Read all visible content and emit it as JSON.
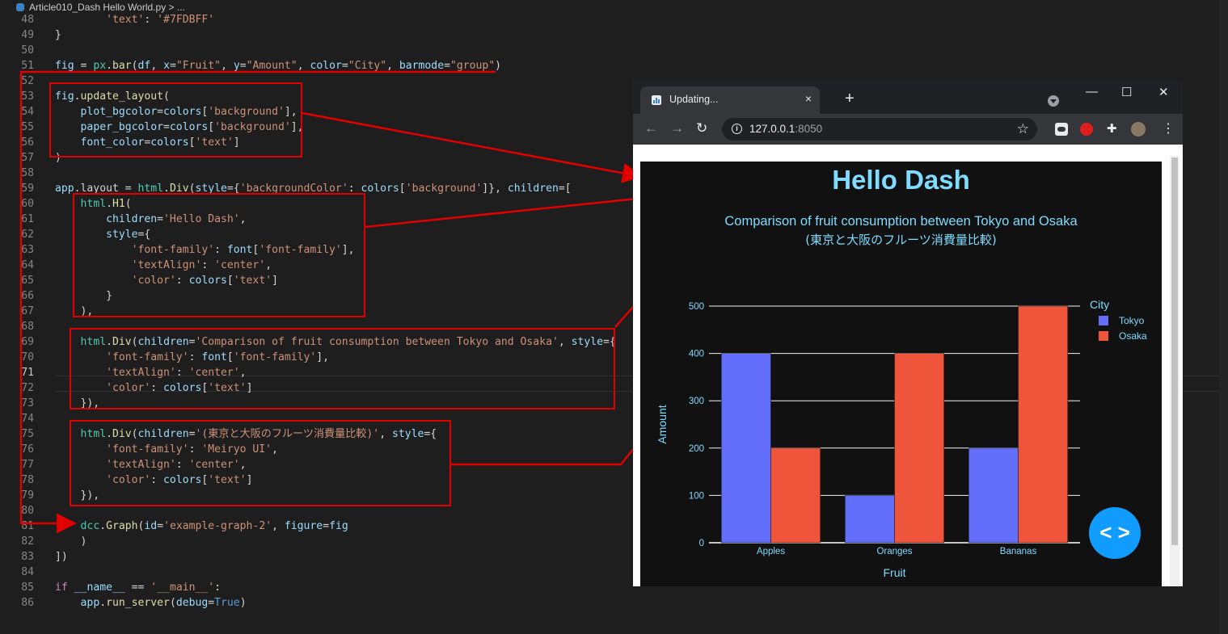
{
  "breadcrumb": {
    "file": "Article010_Dash Hello World.py",
    "sep": " > ..."
  },
  "code_lines": [
    {
      "n": "48",
      "t": "        'text': '#7FDBFF'"
    },
    {
      "n": "49",
      "t": "}"
    },
    {
      "n": "50",
      "t": ""
    },
    {
      "n": "51",
      "t": "fig = px.bar(df, x=\"Fruit\", y=\"Amount\", color=\"City\", barmode=\"group\")"
    },
    {
      "n": "52",
      "t": ""
    },
    {
      "n": "53",
      "t": "fig.update_layout("
    },
    {
      "n": "54",
      "t": "    plot_bgcolor=colors['background'],"
    },
    {
      "n": "55",
      "t": "    paper_bgcolor=colors['background'],"
    },
    {
      "n": "56",
      "t": "    font_color=colors['text']"
    },
    {
      "n": "57",
      "t": ")"
    },
    {
      "n": "58",
      "t": ""
    },
    {
      "n": "59",
      "t": "app.layout = html.Div(style={'backgroundColor': colors['background']}, children=["
    },
    {
      "n": "60",
      "t": "    html.H1("
    },
    {
      "n": "61",
      "t": "        children='Hello Dash',"
    },
    {
      "n": "62",
      "t": "        style={"
    },
    {
      "n": "63",
      "t": "            'font-family': font['font-family'],"
    },
    {
      "n": "64",
      "t": "            'textAlign': 'center',"
    },
    {
      "n": "65",
      "t": "            'color': colors['text']"
    },
    {
      "n": "66",
      "t": "        }"
    },
    {
      "n": "67",
      "t": "    ),"
    },
    {
      "n": "68",
      "t": ""
    },
    {
      "n": "69",
      "t": "    html.Div(children='Comparison of fruit consumption between Tokyo and Osaka', style={"
    },
    {
      "n": "70",
      "t": "        'font-family': font['font-family'],"
    },
    {
      "n": "71",
      "t": "        'textAlign': 'center',"
    },
    {
      "n": "72",
      "t": "        'color': colors['text']"
    },
    {
      "n": "73",
      "t": "    }),"
    },
    {
      "n": "74",
      "t": ""
    },
    {
      "n": "75",
      "t": "    html.Div(children='(東京と大阪のフルーツ消費量比較)', style={"
    },
    {
      "n": "76",
      "t": "        'font-family': 'Meiryo UI',"
    },
    {
      "n": "77",
      "t": "        'textAlign': 'center',"
    },
    {
      "n": "78",
      "t": "        'color': colors['text']"
    },
    {
      "n": "79",
      "t": "    }),"
    },
    {
      "n": "80",
      "t": ""
    },
    {
      "n": "81",
      "t": "    dcc.Graph(id='example-graph-2', figure=fig"
    },
    {
      "n": "82",
      "t": "    )"
    },
    {
      "n": "83",
      "t": "])"
    },
    {
      "n": "84",
      "t": ""
    },
    {
      "n": "85",
      "t": "if __name__ == '__main__':"
    },
    {
      "n": "86",
      "t": "    app.run_server(debug=True)"
    }
  ],
  "current_line": "71",
  "browser": {
    "tab_title": "Updating...",
    "tab_close": "×",
    "new_tab": "+",
    "minimize": "—",
    "maximize": "☐",
    "close": "✕",
    "url_host": "127.0.0.1",
    "url_port": ":8050",
    "back": "←",
    "forward": "→",
    "reload": "↻",
    "star": "☆",
    "menu": "⋮",
    "puzzle": "✚"
  },
  "dash": {
    "title": "Hello Dash",
    "subtitle_en": "Comparison of fruit consumption between Tokyo and Osaka",
    "subtitle_ja": "(東京と大阪のフルーツ消費量比較)",
    "debug_button": "< >",
    "text_color": "#7FDBFF",
    "background": "#111111"
  },
  "chart_data": {
    "type": "bar",
    "barmode": "group",
    "categories": [
      "Apples",
      "Oranges",
      "Bananas"
    ],
    "series": [
      {
        "name": "Tokyo",
        "values": [
          400,
          100,
          200
        ],
        "color": "#636efa"
      },
      {
        "name": "Osaka",
        "values": [
          200,
          400,
          500
        ],
        "color": "#ef553b"
      }
    ],
    "xlabel": "Fruit",
    "ylabel": "Amount",
    "legend_title": "City",
    "yticks": [
      0,
      100,
      200,
      300,
      400,
      500
    ],
    "ylim": [
      0,
      500
    ],
    "grid": true,
    "legend_position": "top-right"
  }
}
